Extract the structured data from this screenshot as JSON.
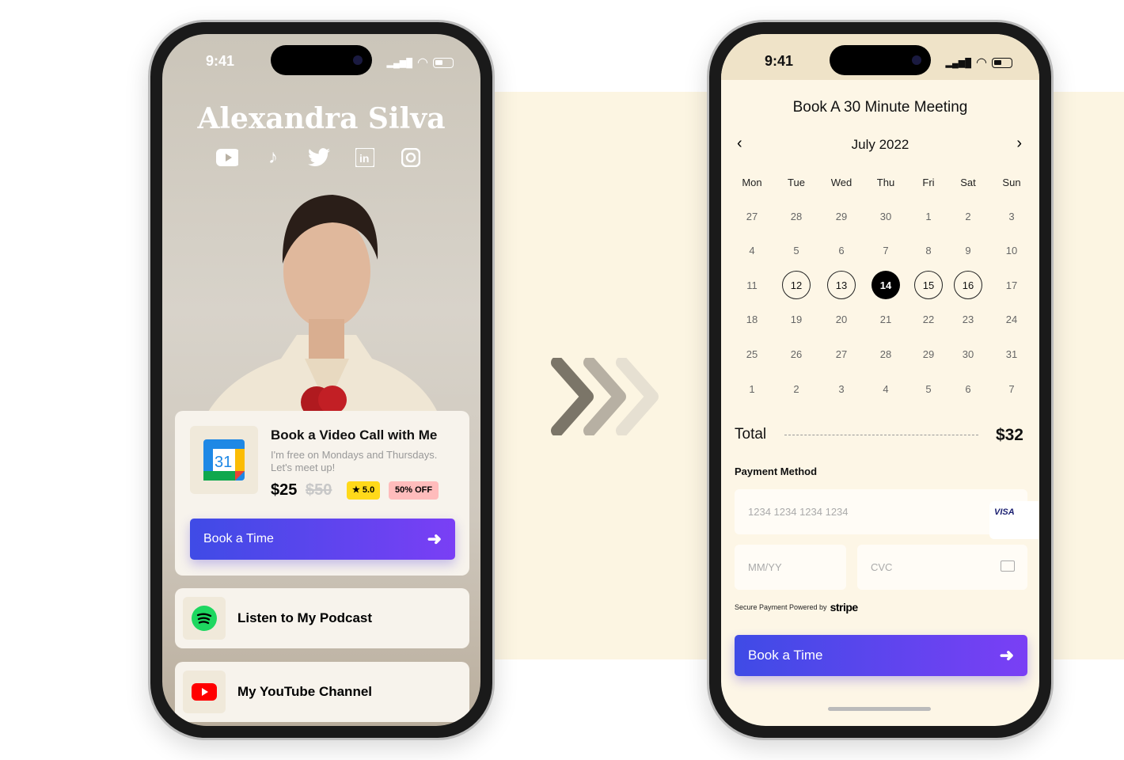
{
  "left_phone": {
    "status_time": "9:41",
    "profile_name": "Alexandra Silva",
    "socials": [
      "youtube-icon",
      "tiktok-icon",
      "twitter-icon",
      "linkedin-icon",
      "instagram-icon"
    ],
    "video_card": {
      "title": "Book a Video Call with Me",
      "description": "I'm free on Mondays and Thursdays. Let's meet up!",
      "price": "$25",
      "original_price": "$50",
      "rating": "★ 5.0",
      "discount": "50% OFF",
      "calendar_icon_text": "31",
      "button_label": "Book a Time"
    },
    "podcast_card": {
      "title": "Listen to My Podcast"
    },
    "youtube_card": {
      "title": "My YouTube Channel"
    }
  },
  "right_phone": {
    "status_time": "9:41",
    "title": "Book A 30 Minute Meeting",
    "month": "July 2022",
    "weekdays": [
      "Mon",
      "Tue",
      "Wed",
      "Thu",
      "Fri",
      "Sat",
      "Sun"
    ],
    "weeks": [
      [
        "27",
        "28",
        "29",
        "30",
        "1",
        "2",
        "3"
      ],
      [
        "4",
        "5",
        "6",
        "7",
        "8",
        "9",
        "10"
      ],
      [
        "11",
        "12",
        "13",
        "14",
        "15",
        "16",
        "17"
      ],
      [
        "18",
        "19",
        "20",
        "21",
        "22",
        "23",
        "24"
      ],
      [
        "25",
        "26",
        "27",
        "28",
        "29",
        "30",
        "31"
      ],
      [
        "1",
        "2",
        "3",
        "4",
        "5",
        "6",
        "7"
      ]
    ],
    "available_days": [
      "12",
      "13",
      "15",
      "16"
    ],
    "selected_day": "14",
    "total_label": "Total",
    "total_value": "$32",
    "payment_label": "Payment Method",
    "card_placeholder": "1234 1234 1234 1234",
    "card_brand": "VISA",
    "expiry_placeholder": "MM/YY",
    "cvc_placeholder": "CVC",
    "secure_text": "Secure Payment Powered by",
    "stripe": "stripe",
    "button_label": "Book a Time"
  },
  "colors": {
    "accent_start": "#3f4be6",
    "accent_end": "#7a3ff5",
    "cream": "#fcf5e2",
    "rating": "#ffd91a",
    "discount": "#ffbcbc"
  }
}
